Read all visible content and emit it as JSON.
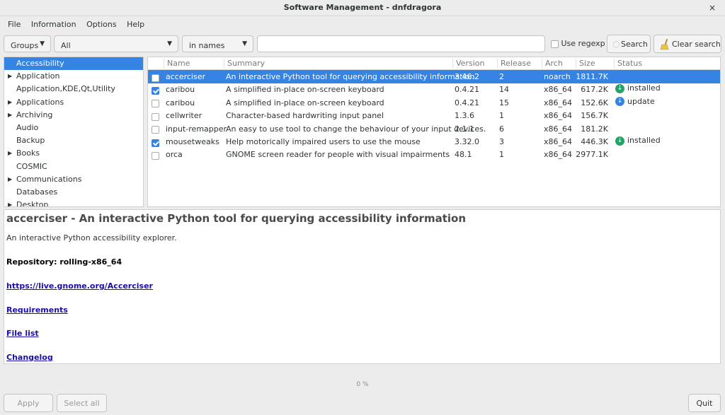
{
  "window": {
    "title": "Software Management - dnfdragora",
    "close_glyph": "×"
  },
  "menu": [
    "File",
    "Information",
    "Options",
    "Help"
  ],
  "toolbar": {
    "groups_label": "Groups",
    "filter_value": "All",
    "search_in_value": "in names",
    "search_value": "",
    "use_regexp_label": "Use regexp",
    "search_label": "Search",
    "clear_search_label": "Clear search"
  },
  "groups": [
    {
      "label": "Accessibility",
      "expandable": false,
      "selected": true
    },
    {
      "label": "Application",
      "expandable": true
    },
    {
      "label": "Application,KDE,Qt,Utility",
      "expandable": false
    },
    {
      "label": "Applications",
      "expandable": true
    },
    {
      "label": "Archiving",
      "expandable": true
    },
    {
      "label": "Audio",
      "expandable": false
    },
    {
      "label": "Backup",
      "expandable": false
    },
    {
      "label": "Books",
      "expandable": true
    },
    {
      "label": "COSMIC",
      "expandable": false
    },
    {
      "label": "Communications",
      "expandable": true
    },
    {
      "label": "Databases",
      "expandable": false
    },
    {
      "label": "Desktop",
      "expandable": true
    }
  ],
  "table": {
    "headers": [
      "Name",
      "Summary",
      "Version",
      "Release",
      "Arch",
      "Size",
      "Status"
    ],
    "rows": [
      {
        "checked": false,
        "selected": true,
        "name": "accerciser",
        "summary": "An interactive Python tool for querying accessibility information",
        "version": "3.46.2",
        "release": "2",
        "arch": "noarch",
        "size": "1811.7K",
        "status": ""
      },
      {
        "checked": true,
        "name": "caribou",
        "summary": "A simplified in-place on-screen keyboard",
        "version": "0.4.21",
        "release": "14",
        "arch": "x86_64",
        "size": "617.2K",
        "status": "installed",
        "status_icon": "installed-icon"
      },
      {
        "checked": false,
        "name": "caribou",
        "summary": "A simplified in-place on-screen keyboard",
        "version": "0.4.21",
        "release": "15",
        "arch": "x86_64",
        "size": "152.6K",
        "status": "update",
        "status_icon": "update-icon"
      },
      {
        "checked": false,
        "name": "cellwriter",
        "summary": "Character-based hardwriting input panel",
        "version": "1.3.6",
        "release": "1",
        "arch": "x86_64",
        "size": "156.7K",
        "status": ""
      },
      {
        "checked": false,
        "name": "input-remapper",
        "summary": "An easy to use tool to change the behaviour of your input devices.",
        "version": "2.1.1",
        "release": "6",
        "arch": "x86_64",
        "size": "181.2K",
        "status": ""
      },
      {
        "checked": true,
        "name": "mousetweaks",
        "summary": "Help motorically impaired users to use the mouse",
        "version": "3.32.0",
        "release": "3",
        "arch": "x86_64",
        "size": "446.3K",
        "status": "installed",
        "status_icon": "installed-icon"
      },
      {
        "checked": false,
        "name": "orca",
        "summary": "GNOME screen reader for people with visual impairments",
        "version": "48.1",
        "release": "1",
        "arch": "x86_64",
        "size": "2977.1K",
        "status": ""
      }
    ]
  },
  "info": {
    "title": "accerciser - An interactive Python tool for querying accessibility information",
    "description": "An interactive Python accessibility explorer.",
    "repository": "Repository: rolling-x86_64",
    "links": [
      "https://live.gnome.org/Accerciser",
      "Requirements",
      "File list",
      "Changelog"
    ]
  },
  "progress": "0 %",
  "bottom": {
    "apply_label": "Apply",
    "select_all_label": "Select all",
    "quit_label": "Quit"
  },
  "colors": {
    "accent": "#3584e4",
    "installed": "#26a269",
    "update": "#3584e4"
  }
}
